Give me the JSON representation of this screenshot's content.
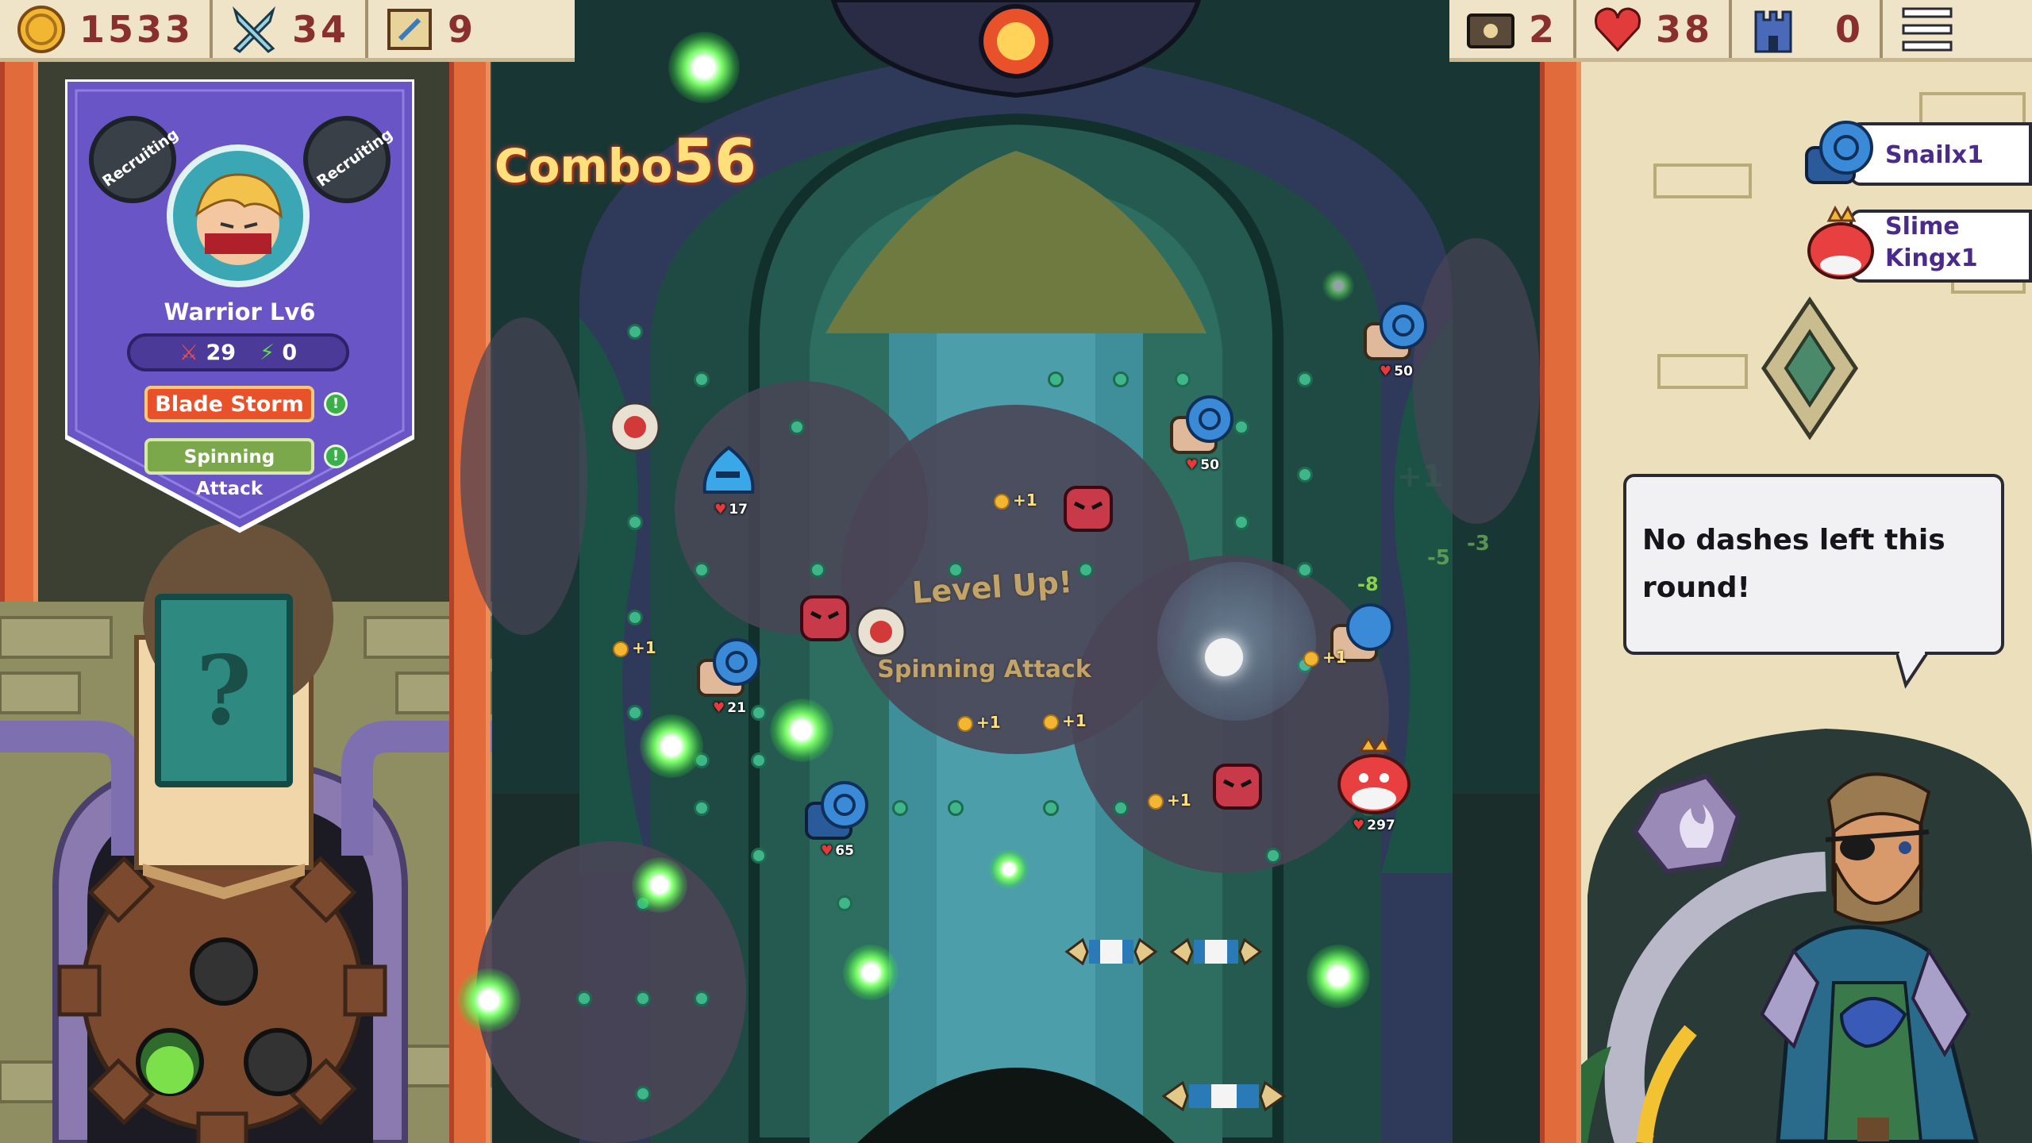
{
  "hud_left": {
    "gold": "1533",
    "attack": "34",
    "map": "9"
  },
  "hud_right": {
    "keys": "2",
    "health": "38",
    "castle": "0"
  },
  "combo": {
    "label": "Combo",
    "value": "56"
  },
  "hero": {
    "recruit_left": "Recruiting",
    "recruit_right": "Recruiting",
    "name": "Warrior",
    "level": "Lv6",
    "attack": "29",
    "energy": "0",
    "skills": [
      {
        "label": "Blade Storm",
        "color": "#e8512a"
      },
      {
        "label": "Spinning Attack",
        "color": "#7aa84a"
      }
    ]
  },
  "mystery_card": {
    "symbol": "?"
  },
  "level_up": {
    "title": "Level Up!",
    "skill": "Spinning Attack"
  },
  "enemies": [
    {
      "name": "blue-slime",
      "hp": "17"
    },
    {
      "name": "snail",
      "hp": "21"
    },
    {
      "name": "snail-blue",
      "hp": "65"
    },
    {
      "name": "snail-top",
      "hp": "50"
    },
    {
      "name": "snail-mid",
      "hp": "50"
    },
    {
      "name": "slime-king",
      "hp": "297"
    }
  ],
  "coin_pops": [
    "+1",
    "+1",
    "+1",
    "+1",
    "+1",
    "+1"
  ],
  "floating_numbers": [
    "+1",
    "-8",
    "-5",
    "-3"
  ],
  "queue": [
    {
      "label": "Snailx1"
    },
    {
      "label": "Slime\nKingx1"
    }
  ],
  "speech": {
    "text": "No dashes left this round!"
  },
  "colors": {
    "hud_bg": "#efe3c8",
    "hud_number": "#8a2f2f",
    "board_bg": "#1d4440",
    "hero_card": "#6a55c6",
    "combo": "#ffe07a",
    "queue_label": "#4a2a8a"
  }
}
